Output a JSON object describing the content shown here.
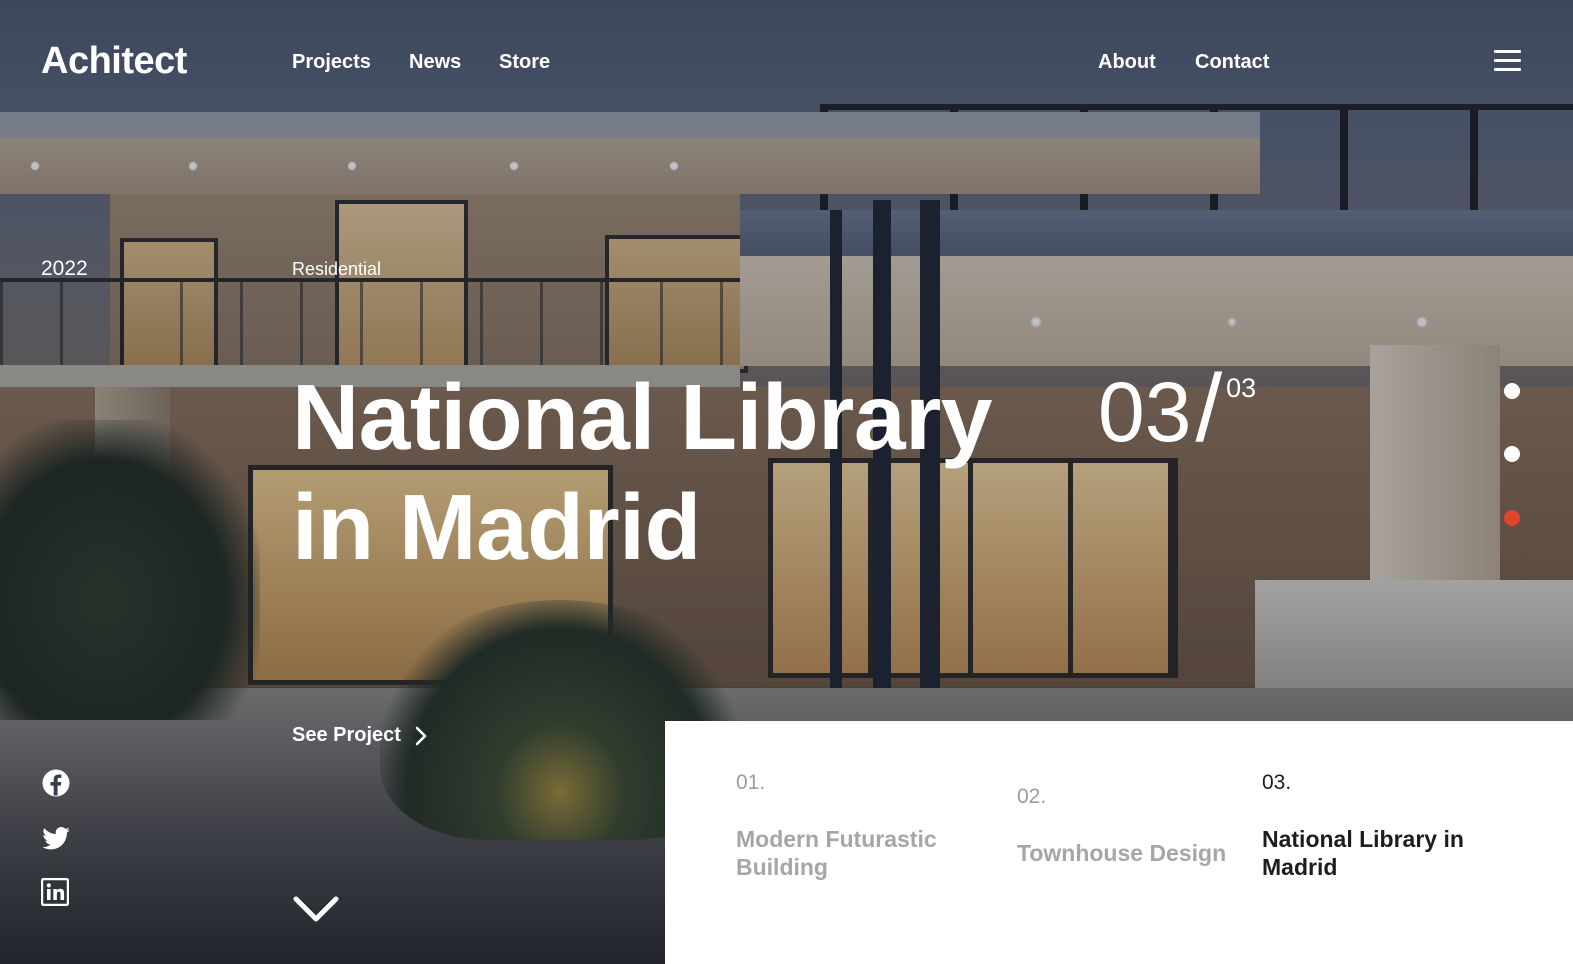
{
  "brand": {
    "logo": "Achitect"
  },
  "nav": {
    "left": [
      "Projects",
      "News",
      "Store"
    ],
    "right": [
      "About",
      "Contact"
    ],
    "menu_icon": "hamburger-menu-icon"
  },
  "hero": {
    "year": "2022",
    "category": "Residential",
    "title_line1": "National Library",
    "title_line2": "in Madrid",
    "counter_current": "03",
    "counter_separator": "/",
    "counter_total": "03",
    "cta_label": "See Project",
    "cta_icon": "chevron-right-icon",
    "scroll_icon": "chevron-down-icon",
    "slide_dots": {
      "count": 3,
      "active_index": 2
    },
    "accent_color": "#e0472a"
  },
  "social": [
    "facebook-icon",
    "twitter-icon",
    "linkedin-icon"
  ],
  "projects": [
    {
      "num": "01.",
      "name": "Modern Futurastic Building",
      "active": false
    },
    {
      "num": "02.",
      "name": "Townhouse Design",
      "active": false
    },
    {
      "num": "03.",
      "name": "National Library in Madrid",
      "active": true
    }
  ]
}
